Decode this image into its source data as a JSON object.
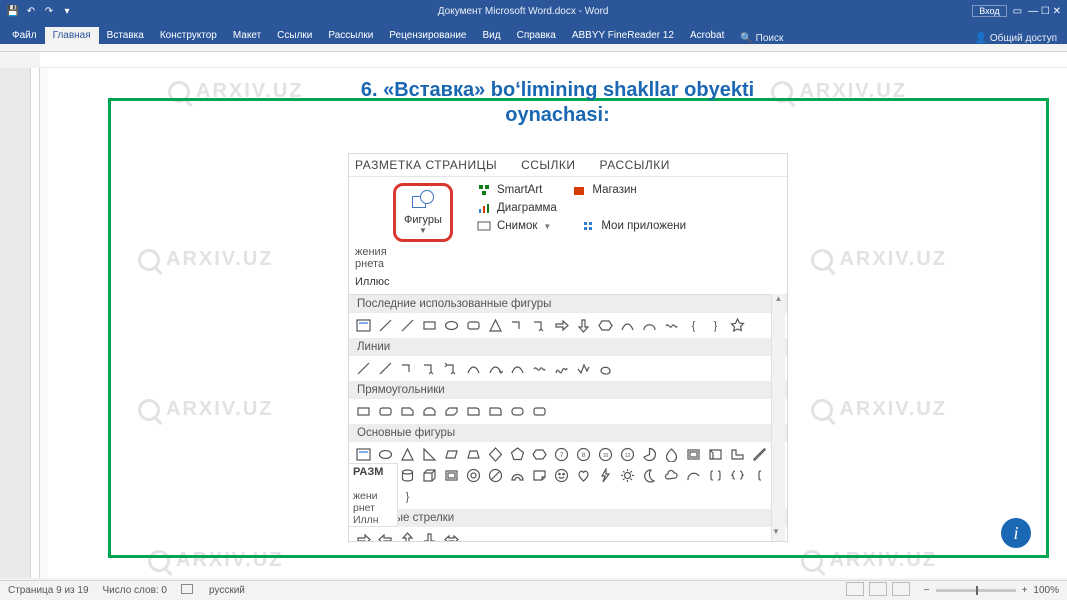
{
  "titlebar": {
    "title": "Документ Microsoft Word.docx - Word",
    "login": "Вход",
    "account": "Общий доступ"
  },
  "ribbon": {
    "tabs": [
      "Файл",
      "Главная",
      "Вставка",
      "Конструктор",
      "Макет",
      "Ссылки",
      "Рассылки",
      "Рецензирование",
      "Вид",
      "Справка",
      "ABBYY FineReader 12",
      "Acrobat"
    ],
    "active": "Главная",
    "search": "Поиск"
  },
  "heading": {
    "line1": "6. «Вставка» boʻlimining shakllar obyekti",
    "line2": "oynachasi:"
  },
  "watermark": "ARXIV.UZ",
  "inner": {
    "tabs": [
      "РАЗМЕТКА СТРАНИЦЫ",
      "ССЫЛКИ",
      "РАССЫЛКИ"
    ],
    "shapes_label": "Фигуры",
    "left_cut1": "жения",
    "left_cut2": "рнета",
    "group_label": "Иллюс",
    "smartart": "SmartArt",
    "diagram": "Диаграмма",
    "snapshot": "Снимок",
    "store": "Магазин",
    "myapps": "Мои приложени"
  },
  "shapes_panel": {
    "cat_recent": "Последние использованные фигуры",
    "cat_lines": "Линии",
    "cat_rects": "Прямоугольники",
    "cat_basic": "Основные фигуры",
    "cat_arrows": "Фигурные стрелки"
  },
  "peek": {
    "hdr": "РАЗМ",
    "l1": "жени",
    "l2": "рнет",
    "l3": "Иллн"
  },
  "statusbar": {
    "page": "Страница 9 из 19",
    "words": "Число слов: 0",
    "lang": "русский",
    "zoom": "100%"
  },
  "info_badge": "i"
}
